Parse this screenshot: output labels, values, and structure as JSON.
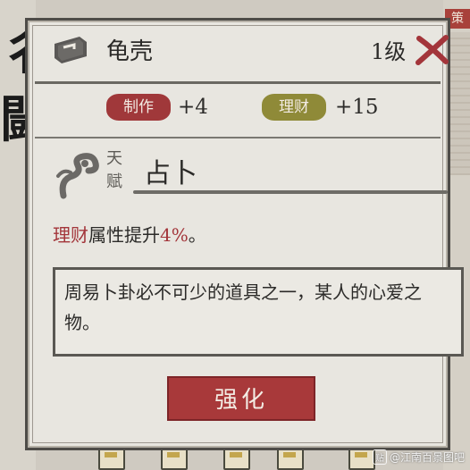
{
  "background": {
    "left_glyphs": "彳\n闘",
    "right_tag": "策"
  },
  "item": {
    "icon": "shell-tablet-icon",
    "name": "龟壳",
    "level": "1级"
  },
  "stats": [
    {
      "tag": "制作",
      "value": "+4",
      "color": "#a0383a"
    },
    {
      "tag": "理财",
      "value": "+15",
      "color": "#8f8a38"
    }
  ],
  "talent": {
    "tag_line1": "天",
    "tag_line2": "赋",
    "icon": "cloud-swirl-icon",
    "name": "占卜"
  },
  "effect": {
    "attribute": "理财",
    "middle": "属性提升",
    "amount": "4%",
    "end": "。"
  },
  "description": "周易卜卦必不可少的道具之一，某人的心爱之物。",
  "actions": {
    "enhance_label": "强化"
  },
  "watermark": {
    "badge": "贴",
    "text": "@江南百景图吧"
  },
  "colors": {
    "accent_red": "#a8393a",
    "olive": "#8f8a38",
    "panel": "#e8e6e0"
  }
}
